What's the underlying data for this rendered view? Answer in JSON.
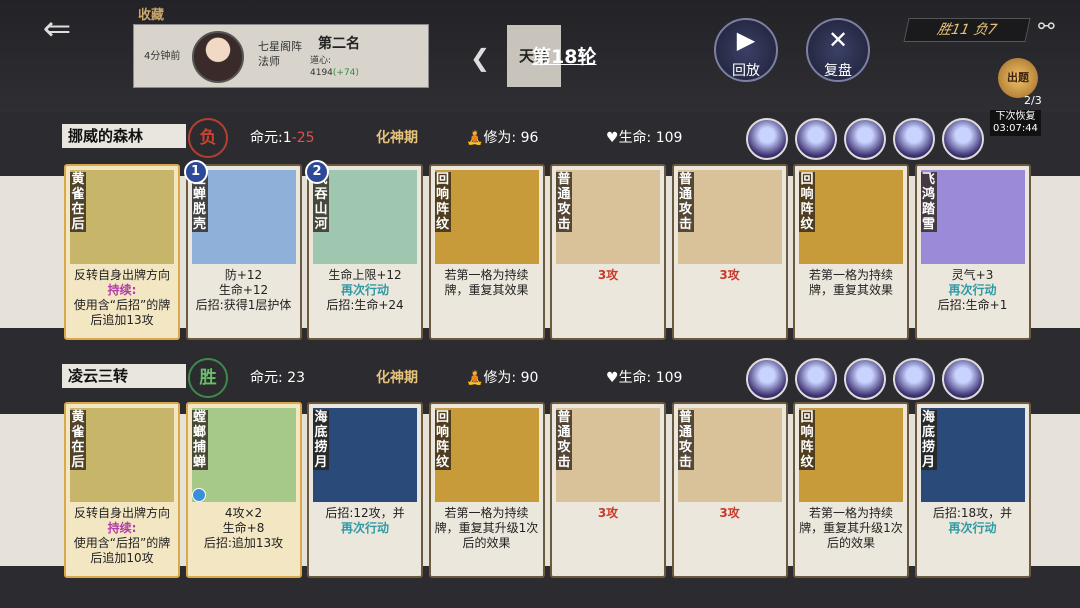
{
  "header": {
    "back_icon": "back-arrow-icon",
    "favorites_label": "收藏",
    "opponent": {
      "time": "4分钟前",
      "sect": "七星阁阵法师",
      "rank": "第二名",
      "dao_label": "道心:",
      "dao_value": "4194",
      "dao_gain": "(+74)",
      "ladder_label": "天梯"
    },
    "round_label": "第18轮",
    "replay_label": "回放",
    "review_label": "复盘",
    "score": "胜11 负7",
    "challenge_label": "出题",
    "challenge_count": "2/3",
    "recover_label": "下次恢复",
    "recover_time": "03:07:44"
  },
  "players": [
    {
      "name": "挪威的森林",
      "result": "负",
      "life_label": "命元:",
      "life_value": "1",
      "life_delta": "-25",
      "realm": "化神期",
      "cult_label": "修为:",
      "cult_value": "96",
      "hp_label": "生命:",
      "hp_value": "109"
    },
    {
      "name": "凌云三转",
      "result": "胜",
      "life_label": "命元:",
      "life_value": "23",
      "life_delta": "",
      "realm": "化神期",
      "cult_label": "修为:",
      "cult_value": "90",
      "hp_label": "生命:",
      "hp_value": "109"
    }
  ],
  "row1": [
    {
      "name": "黄雀在后",
      "d1": "反转自身出牌方向",
      "d2": "持续:",
      "d3": "使用含“后招”的牌后追加13攻"
    },
    {
      "name": "金蝉脱壳",
      "badge": "1",
      "d1": "防+12",
      "d2": "生命+12",
      "d3": "后招:获得1层护体"
    },
    {
      "name": "气吞山河",
      "badge": "2",
      "d1": "生命上限+12",
      "d2": "再次行动",
      "d3": "后招:生命+24"
    },
    {
      "name": "回响阵纹",
      "d1": "若第一格为持续牌，重复其效果"
    },
    {
      "name": "普通攻击",
      "d1": "3攻"
    },
    {
      "name": "普通攻击",
      "d1": "3攻"
    },
    {
      "name": "回响阵纹",
      "d1": "若第一格为持续牌，重复其效果"
    },
    {
      "name": "飞鸿踏雪",
      "d1": "灵气+3",
      "d2": "再次行动",
      "d3": "后招:生命+1"
    }
  ],
  "row2": [
    {
      "name": "黄雀在后",
      "d1": "反转自身出牌方向",
      "d2": "持续:",
      "d3": "使用含“后招”的牌后追加10攻"
    },
    {
      "name": "螳螂捕蝉",
      "d1": "4攻×2",
      "d2": "生命+8",
      "d3": "后招:追加13攻"
    },
    {
      "name": "海底捞月",
      "d1": "后招:12攻，并",
      "d2": "再次行动"
    },
    {
      "name": "回响阵纹",
      "d1": "若第一格为持续牌，重复其升级1次后的效果"
    },
    {
      "name": "普通攻击",
      "d1": "3攻"
    },
    {
      "name": "普通攻击",
      "d1": "3攻"
    },
    {
      "name": "回响阵纹",
      "d1": "若第一格为持续牌，重复其升级1次后的效果"
    },
    {
      "name": "海底捞月",
      "d1": "后招:18攻，并",
      "d2": "再次行动"
    }
  ]
}
